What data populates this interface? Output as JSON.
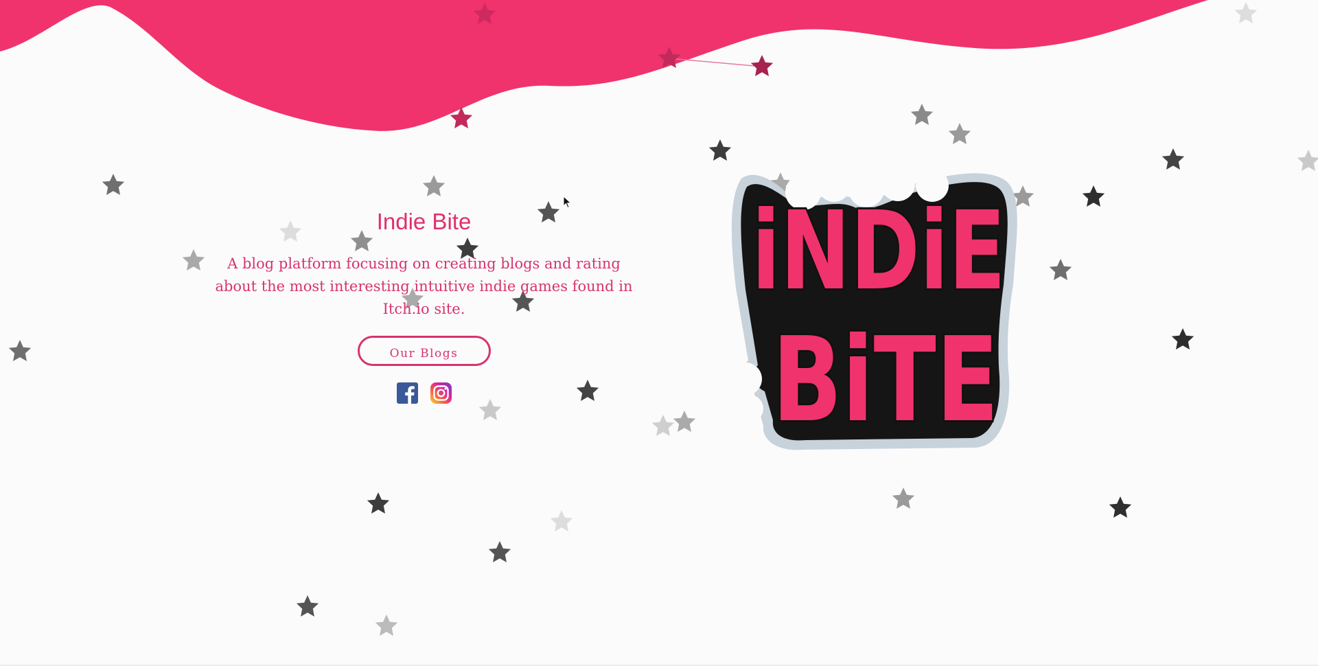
{
  "hero": {
    "title": "Indie Bite",
    "description": "A blog platform focusing on creating blogs and rating about the most interesting intuitive indie games found in Itch.io site.",
    "button_label": "Our Blogs"
  },
  "social": {
    "facebook_icon": "facebook-icon",
    "instagram_icon": "instagram-icon"
  },
  "logo": {
    "text_line_1": "iNDiE",
    "text_line_2": "BiTE"
  },
  "colors": {
    "accent": "#f0336c",
    "text_accent": "#d6336f",
    "background": "#fcfbfc"
  }
}
